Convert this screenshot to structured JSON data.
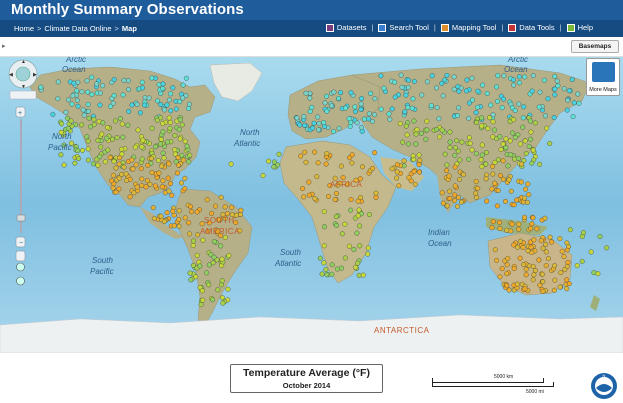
{
  "header": {
    "title": "Monthly Summary Observations"
  },
  "breadcrumb": {
    "home": "Home",
    "sep1": ">",
    "cdo": "Climate Data Online",
    "sep2": ">",
    "current": "Map"
  },
  "menu": {
    "items": [
      {
        "label": "Datasets",
        "color": "#7a3c7a"
      },
      {
        "label": "Search Tool",
        "color": "#3a7ed1"
      },
      {
        "label": "Mapping Tool",
        "color": "#e08e2a"
      },
      {
        "label": "Data Tools",
        "color": "#c43434"
      },
      {
        "label": "Help",
        "color": "#7ab83a"
      }
    ],
    "divider": "|"
  },
  "toolbar": {
    "collapse_glyph": "▸",
    "basemaps_label": "Basemaps"
  },
  "more_maps": {
    "label": "More Maps"
  },
  "map": {
    "labels": {
      "arctic_ocean_left": "Arctic\nOcean",
      "arctic_ocean_right": "Arctic\nOcean",
      "north_pacific": "North\nPacific",
      "north_atlantic": "North\nAtlantic",
      "africa": "AFRICA",
      "south_america": "SOUTH\nAMERICA",
      "indian_ocean": "Indian\nOcean",
      "south_atlantic": "South\nAtlantic",
      "south_pacific": "South\nPacific",
      "antarctica": "ANTARCTICA"
    },
    "colors": {
      "ocean": "#7fbfe0",
      "land": "#b9b187",
      "station_cold": "#4fd6e0",
      "station_mid": "#b6d03e",
      "station_warm": "#e6a52a"
    }
  },
  "legend": {
    "title": "Temperature Average (°F)",
    "period": "October 2014"
  },
  "scale": {
    "km": "5000 km",
    "mi": "5000 mi"
  },
  "logo": {
    "text": "NOAA"
  }
}
